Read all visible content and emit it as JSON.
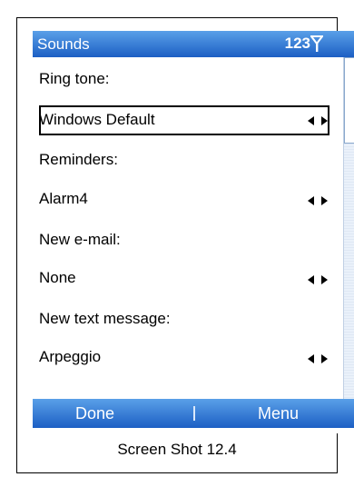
{
  "screen": {
    "title": "Sounds",
    "status_text": "123",
    "icons": {
      "signal": "signal-icon",
      "arrows": "left-right-arrows-icon"
    }
  },
  "settings": [
    {
      "label": "Ring tone:",
      "value": "Windows Default"
    },
    {
      "label": "Reminders:",
      "value": "Alarm4"
    },
    {
      "label": "New e-mail:",
      "value": "None"
    },
    {
      "label": "New text message:",
      "value": "Arpeggio"
    }
  ],
  "softkeys": {
    "left": "Done",
    "right": "Menu"
  },
  "caption": "Screen Shot 12.4",
  "colors": {
    "bar_top": "#5aa0e8",
    "bar_bottom": "#1c5fc4"
  }
}
